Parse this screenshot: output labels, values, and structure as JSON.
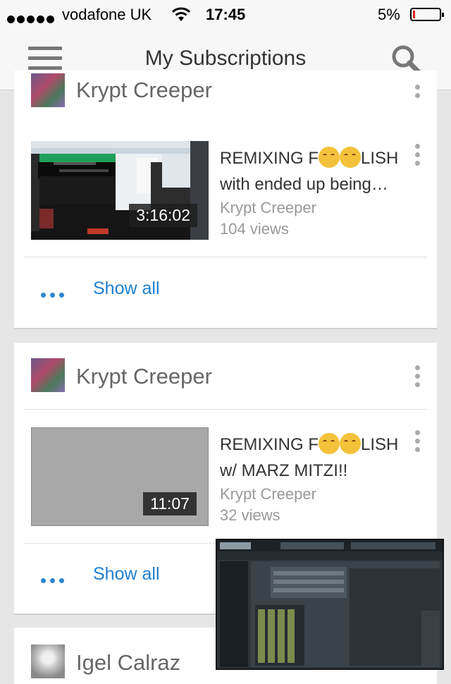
{
  "status_bar": {
    "carrier": "vodafone UK",
    "time": "17:45",
    "battery": "5%"
  },
  "app_bar": {
    "title": "My Subscriptions"
  },
  "feed": [
    {
      "channel": "Krypt Creeper",
      "video": {
        "title_prefix": "REMIXING F",
        "title_suffix": "LISH",
        "title_line2": "with ended up being…",
        "channel": "Krypt Creeper",
        "views": "104 views",
        "duration": "3:16:02"
      },
      "show_all": "Show all"
    },
    {
      "channel": "Krypt Creeper",
      "video": {
        "title_prefix": "REMIXING F",
        "title_suffix": "LISH",
        "title_line2": "w/ MARZ MITZI!!",
        "channel": "Krypt Creeper",
        "views": "32 views",
        "duration": "11:07"
      },
      "show_all": "Show all"
    },
    {
      "channel": "Igel Calraz"
    }
  ],
  "colors": {
    "accent": "#1f7fce",
    "battery_low": "#e0221c",
    "background": "#e6e6e6"
  },
  "icons": [
    "signal-icon",
    "wifi-icon",
    "battery-icon",
    "menu-icon",
    "search-icon",
    "more-vert-icon",
    "more-horiz-icon",
    "smiling-emoji-icon"
  ]
}
